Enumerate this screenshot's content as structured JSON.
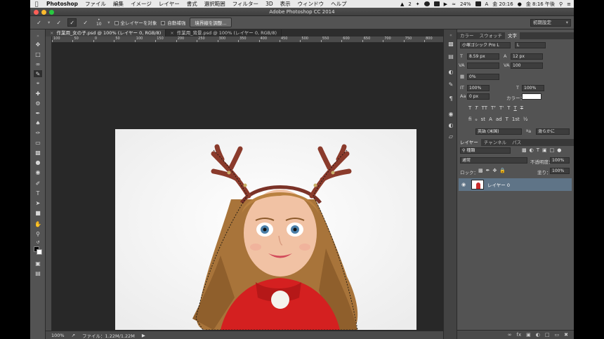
{
  "menubar": {
    "app_name": "Photoshop",
    "items": [
      "ファイル",
      "編集",
      "イメージ",
      "レイヤー",
      "書式",
      "選択範囲",
      "フィルター",
      "3D",
      "表示",
      "ウィンドウ",
      "ヘルプ"
    ],
    "status_badge": "2",
    "battery": "24%",
    "input_mode": "A",
    "clock1": "金 20:16",
    "clock2": "金 8:16 午後"
  },
  "title": "Adobe Photoshop CC 2014",
  "options": {
    "brush_size": "10",
    "sample_all_layers": "全レイヤーを対象",
    "auto_enhance": "自動補強",
    "refine_edge": "境界線を調整...",
    "workspace": "初期設定"
  },
  "tabs": [
    {
      "label": "作業用_女の子.psd @ 100% (レイヤー 0, RGB/8)"
    },
    {
      "label": "作業用_背景.psd @ 100% (レイヤー 0, RGB/8)"
    }
  ],
  "ruler": {
    "labels": [
      "100",
      "50",
      "0",
      "50",
      "100",
      "150",
      "200",
      "250",
      "300",
      "350",
      "400",
      "450",
      "500",
      "550",
      "600",
      "650",
      "700",
      "750",
      "800",
      "850"
    ]
  },
  "status": {
    "zoom": "100%",
    "file_info": "ファイル：1.22M/1.22M"
  },
  "character_panel": {
    "tabs": [
      "カラー",
      "スウォッチ",
      "文字"
    ],
    "font_family": "小塚ゴシック Pro L",
    "font_style": "L",
    "font_size": "8.59 px",
    "leading": "12 px",
    "kerning": "",
    "tracking": "100",
    "tsume": "0%",
    "vertical_scale": "100%",
    "horizontal_scale": "100%",
    "baseline_shift": "0 px",
    "color_label": "カラー：",
    "glyphs1": [
      "T",
      "T",
      "TT",
      "Tᵀ",
      "T'",
      "T",
      "T",
      "T"
    ],
    "glyphs2": [
      "ﬁ",
      "ℴ",
      "st",
      "A",
      "ad",
      "T",
      "1st",
      "½"
    ],
    "language": "英語 (米国)",
    "antialias_label": "ªa",
    "antialias": "滑らかに"
  },
  "layers_panel": {
    "tabs": [
      "レイヤー",
      "チャンネル",
      "パス"
    ],
    "filter_kind": "種類",
    "blend_mode": "通常",
    "opacity_label": "不透明度：",
    "opacity": "100%",
    "lock_label": "ロック：",
    "fill_label": "塗り：",
    "fill": "100%",
    "layer_name": "レイヤー 0"
  },
  "colors": {
    "accent_selected_layer": "#5f7487",
    "panel_bg": "#535353",
    "pasteboard": "#282828"
  }
}
